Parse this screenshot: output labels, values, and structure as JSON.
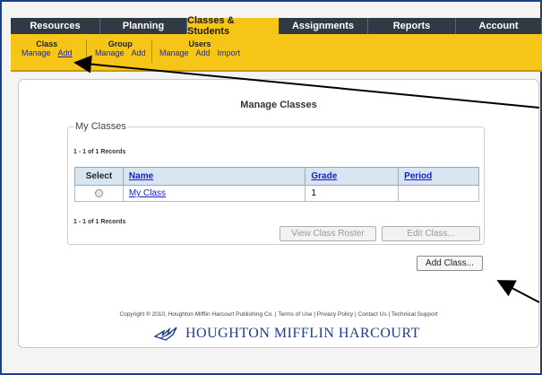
{
  "nav": {
    "tabs": [
      {
        "label": "Resources",
        "active": false
      },
      {
        "label": "Planning",
        "active": false
      },
      {
        "label": "Classes & Students",
        "active": true
      },
      {
        "label": "Assignments",
        "active": false
      },
      {
        "label": "Reports",
        "active": false
      },
      {
        "label": "Account",
        "active": false
      }
    ]
  },
  "subnav": {
    "class": {
      "title": "Class",
      "manage": "Manage",
      "add": "Add"
    },
    "group": {
      "title": "Group",
      "manage": "Manage",
      "add": "Add"
    },
    "users": {
      "title": "Users",
      "manage": "Manage",
      "add": "Add",
      "import": "Import"
    }
  },
  "page": {
    "title": "Manage Classes",
    "section_label": "My Classes",
    "records_top": "1 - 1 of 1 Records",
    "records_bottom": "1 - 1 of 1 Records"
  },
  "table": {
    "headers": {
      "select": "Select",
      "name": "Name",
      "grade": "Grade",
      "period": "Period"
    },
    "rows": [
      {
        "name": "My Class",
        "grade": "1",
        "period": ""
      }
    ]
  },
  "buttons": {
    "view_roster": "View Class Roster",
    "edit_class": "Edit Class...",
    "add_class": "Add Class..."
  },
  "footer": {
    "text": "Copyright ® 2010, Houghton Mifflin Harcourt Publishing Co. | Terms of Use | Privacy Policy | Contact Us | Technical Support",
    "brand": "HOUGHTON MIFFLIN HARCOURT"
  },
  "colors": {
    "nav_bg": "#2f3a45",
    "accent": "#f5c518",
    "link": "#1a1acc"
  }
}
